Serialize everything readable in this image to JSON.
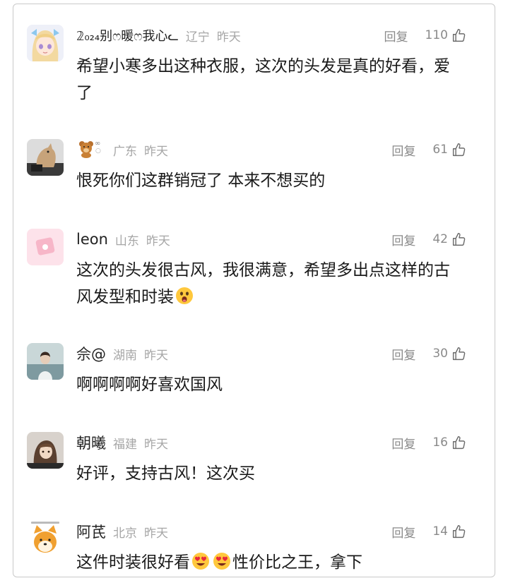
{
  "comments": [
    {
      "user": "𝟚₀₂₄别ෆ暖ෆ我心ᓚ",
      "location": "辽宁",
      "time": "昨天",
      "reply": "回复",
      "likes": "110",
      "text": "希望小寒多出这种衣服，这次的头发是真的好看，爱了"
    },
    {
      "user": "",
      "location": "广东",
      "time": "昨天",
      "reply": "回复",
      "likes": "61",
      "text": "恨死你们这群销冠了 本来不想买的"
    },
    {
      "user": "leon",
      "location": "山东",
      "time": "昨天",
      "reply": "回复",
      "likes": "42",
      "text": "这次的头发很古风，我很满意，希望多出点这样的古风发型和时装"
    },
    {
      "user": "佘@",
      "location": "湖南",
      "time": "昨天",
      "reply": "回复",
      "likes": "30",
      "text": "啊啊啊啊好喜欢国风"
    },
    {
      "user": "朝曦",
      "location": "福建",
      "time": "昨天",
      "reply": "回复",
      "likes": "16",
      "text": "好评，支持古风！这次买"
    },
    {
      "user": "阿芪",
      "location": "北京",
      "time": "昨天",
      "reply": "回复",
      "likes": "14",
      "text_a": "这件时装很好看",
      "text_b": "性价比之王，拿下"
    }
  ],
  "icons": {
    "like": "thumbs-up-icon",
    "emoji_surprised": "surprised-face-emoji",
    "emoji_heart_eyes": "heart-eyes-emoji",
    "bear": "bear-emoji"
  }
}
